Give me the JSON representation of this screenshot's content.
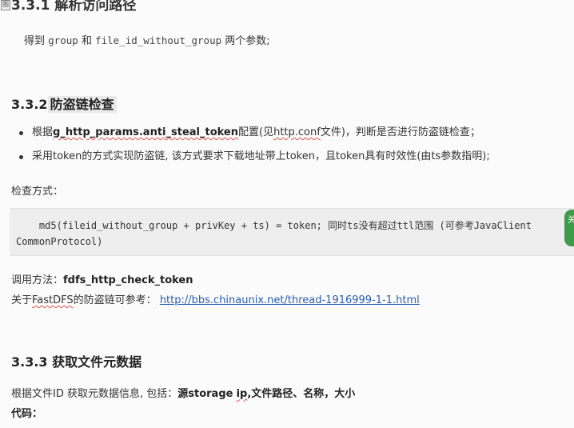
{
  "corner_glyph": "图",
  "section_331": {
    "title": "3.3.1 解析访问路径",
    "intro_prefix": "得到",
    "intro_group": "group",
    "intro_mid": "和",
    "intro_fileid": "file_id_without_group",
    "intro_suffix": "两个参数;"
  },
  "section_332": {
    "num": "3.3.2",
    "title": "防盗链检查",
    "bullet1": {
      "prefix": "根据",
      "config_name": "g_http_params.anti_steal_token",
      "mid": "配置(见",
      "conf_file": "http.conf",
      "suffix": "文件)，判断是否进行防盗链检查；"
    },
    "bullet2": "采用token的方式实现防盗链, 该方式要求下载地址带上token，且token具有时效性(由ts参数指明);",
    "check_method_label": "检查方式：",
    "code_line1": "    md5(fileid_without_group + privKey + ts) = token; 同时ts没有超过ttl范围 (可参考JavaClient",
    "code_line2": "CommonProtocol)",
    "call_method_label": "调用方法：",
    "call_method_value": "fdfs_http_check_token",
    "ref_prefix": "关于",
    "ref_fastdfs": "FastDFS",
    "ref_mid": "的防盗链可参考：",
    "ref_link": "http://bbs.chinaunix.net/thread-1916999-1-1.html"
  },
  "section_333": {
    "title": "3.3.3 获取文件元数据",
    "desc_prefix": "根据文件ID 获取元数据信息, 包括：",
    "desc_bold1": "源storage",
    "desc_ip": "ip",
    "desc_bold2": ",文件路径、名称，大小",
    "code_label": "代码："
  },
  "side_button": {
    "label": "关"
  }
}
